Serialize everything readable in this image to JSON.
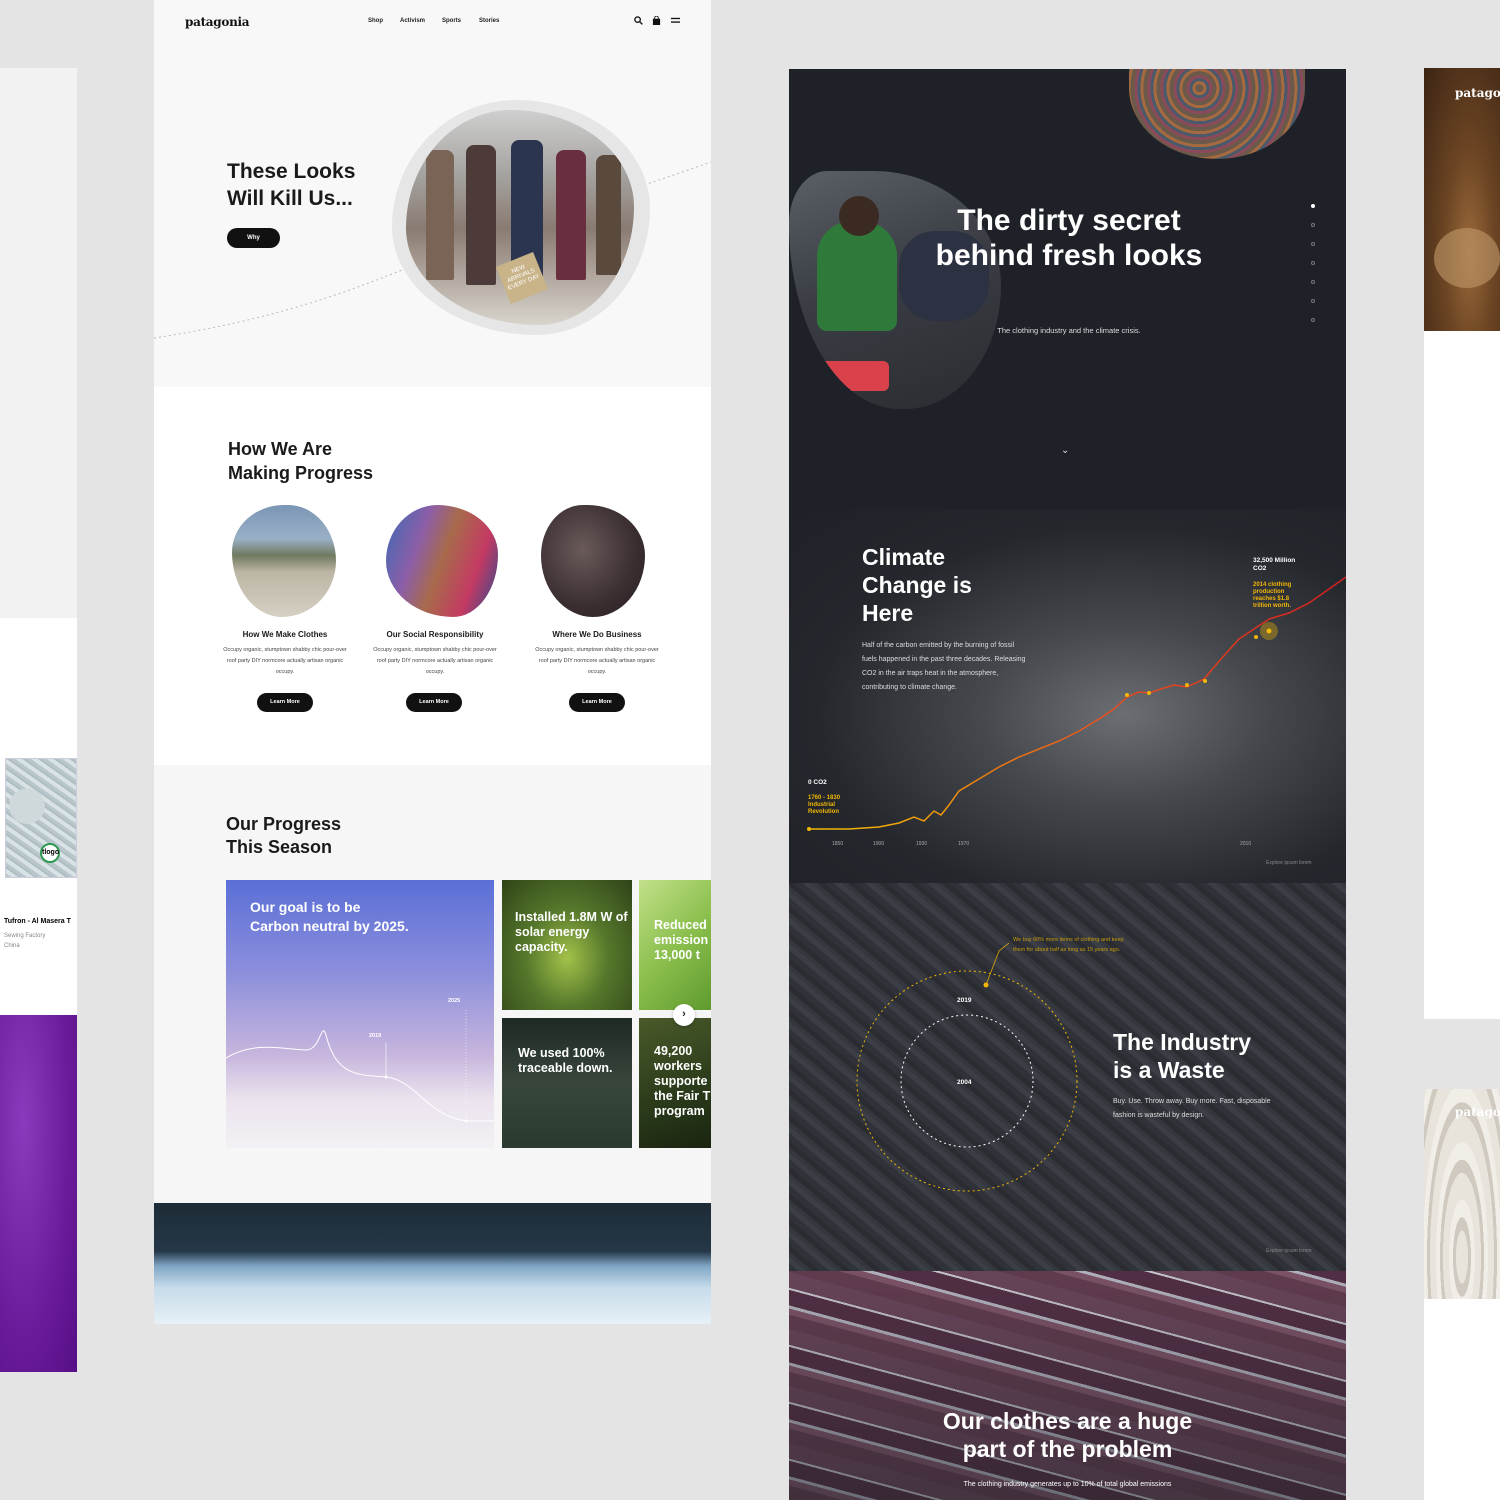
{
  "left_panel": {
    "map_pin_label": "tlogo",
    "caption": "Tufron - Al Masera T",
    "sub1": "Sewing Factory",
    "sub2": "China"
  },
  "site": {
    "logo": "patagonia",
    "nav": [
      "Shop",
      "Activism",
      "Sports",
      "Stories"
    ],
    "icons": [
      "search-icon",
      "bag-icon",
      "menu-icon"
    ],
    "hero": {
      "title_line1": "These Looks",
      "title_line2": "Will Kill Us...",
      "button": "Why",
      "sign_text": "NEW ARRIVALS EVERY DAY"
    },
    "progress": {
      "title_line1": "How We Are",
      "title_line2": "Making Progress",
      "cards": [
        {
          "title": "How We Make Clothes",
          "body": "Occupy organic, stumptown shabby chic pour-over roof party DIY normcore actually artisan organic occupy.",
          "button": "Learn More"
        },
        {
          "title": "Our Social Responsibility",
          "body": "Occupy organic, stumptown shabby chic pour-over roof party DIY normcore actually artisan organic occupy.",
          "button": "Learn More"
        },
        {
          "title": "Where We Do Business",
          "body": "Occupy organic, stumptown shabby chic pour-over roof party DIY normcore actually artisan organic occupy.",
          "button": "Learn More"
        }
      ]
    },
    "season": {
      "title_line1": "Our Progress",
      "title_line2": "This Season",
      "big_tile": {
        "text": "Our goal is to be Carbon neutral by 2025.",
        "label_2019": "2019",
        "label_2025": "2025"
      },
      "tiles": [
        {
          "text": "Installed 1.8M W of solar energy capacity."
        },
        {
          "text": "Reduced emission 13,000 t"
        },
        {
          "text": "We used 100% traceable down."
        },
        {
          "text": "49,200 workers supporte the Fair T program"
        }
      ],
      "next_arrow": "›"
    }
  },
  "dark": {
    "headline": "The dirty secret behind fresh looks",
    "subtitle": "The clothing industry and the climate crisis.",
    "chevron": "⌄",
    "climate": {
      "title_line1": "Climate",
      "title_line2": "Change is",
      "title_line3": "Here",
      "body": "Half of the carbon emitted by the burning of fossil fuels happened in the past three decades. Releasing CO2 in the air traps heat in the atmosphere, contributing to climate change.",
      "label_start": "0 CO2",
      "note_start_line1": "1760 - 1830",
      "note_start_line2": "Industrial",
      "note_start_line3": "Revolution",
      "label_end_line1": "32,500 Million",
      "label_end_line2": "CO2",
      "note_end_line1": "2014 clothing",
      "note_end_line2": "production",
      "note_end_line3": "reaches $1.8",
      "note_end_line4": "trillion worth.",
      "ticks": [
        "1850",
        "1900",
        "1930",
        "1970",
        "2010"
      ],
      "explore": "Explore ipsum lorem"
    },
    "waste": {
      "note": "We buy 60% more items of clothing and keep them for about half as long as 15 years ago.",
      "year_outer": "2019",
      "year_inner": "2004",
      "title_line1": "The Industry",
      "title_line2": "is a Waste",
      "body": "Buy. Use. Throw away. Buy more. Fast, disposable fashion is wasteful by design.",
      "explore": "Explore ipsum lorem"
    },
    "problem": {
      "title_line1": "Our clothes are a huge",
      "title_line2": "part of the problem",
      "body": "The clothing industry generates up to 10% of total global emissions"
    }
  },
  "right_panel": {
    "logo_top": "patagon",
    "logo_bottom": "patagon"
  }
}
